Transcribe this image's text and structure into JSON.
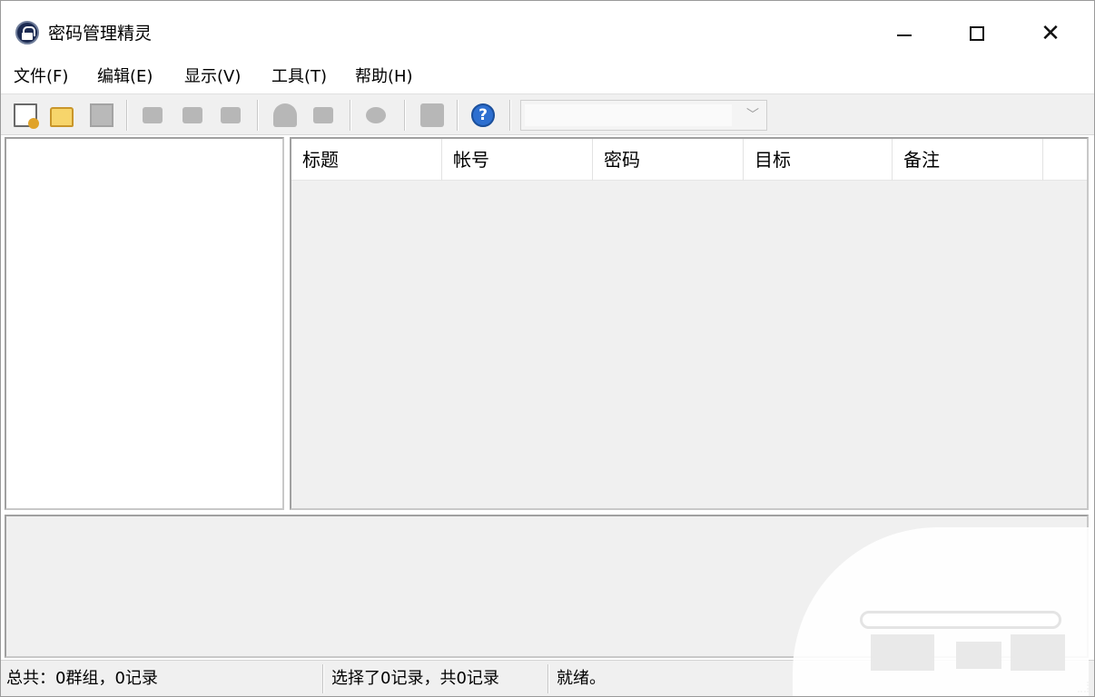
{
  "window": {
    "title": "密码管理精灵",
    "controls": {
      "minimize": "—",
      "maximize": "□",
      "close": "✕"
    }
  },
  "menu": {
    "items": [
      "文件(F)",
      "编辑(E)",
      "显示(V)",
      "工具(T)",
      "帮助(H)"
    ]
  },
  "toolbar": {
    "icons": [
      "new-file-icon",
      "open-folder-icon",
      "save-icon",
      "add-record-icon",
      "edit-record-icon",
      "delete-record-icon",
      "user-icon",
      "folder-icon",
      "search-icon",
      "stop-icon",
      "help-icon"
    ],
    "help_glyph": "?",
    "combo_value": "",
    "combo_arrow": "﹀"
  },
  "list": {
    "columns": [
      "标题",
      "帐号",
      "密码",
      "目标",
      "备注"
    ]
  },
  "status": {
    "summary": "总共：0群组，0记录",
    "selection": "选择了0记录，共0记录",
    "state": "就绪。"
  },
  "colors": {
    "toolbar_bg": "#f0f0f0",
    "panel_border": "#a0a0a0",
    "help_blue": "#2d6fd0",
    "folder_yellow": "#f7d56b"
  }
}
